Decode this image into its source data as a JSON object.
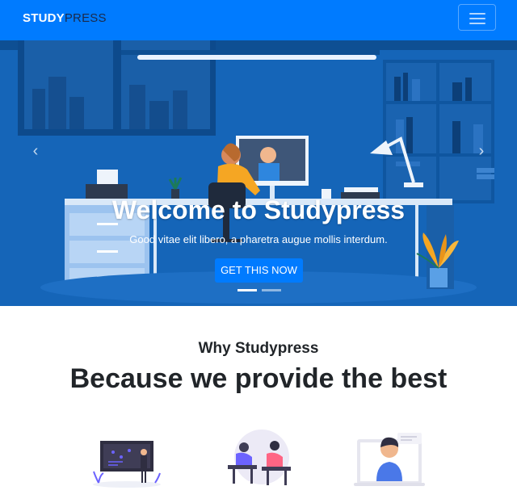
{
  "navbar": {
    "brand_part1": "STUDY",
    "brand_part2": "PRESS",
    "toggle_icon": "hamburger-menu-icon"
  },
  "hero": {
    "title": "Welcome to Studypress",
    "subtitle": "Good vitae elit libero, a pharetra augue mollis interdum.",
    "cta_label": "GET THIS NOW",
    "prev_icon": "chevron-left-icon",
    "next_icon": "chevron-right-icon",
    "prev_glyph": "‹",
    "next_glyph": "›",
    "slide_count": 2,
    "active_slide": 1
  },
  "why": {
    "subtitle": "Why Studypress",
    "title": "Because we provide the best"
  },
  "features": [
    {
      "icon": "teacher-presentation-icon"
    },
    {
      "icon": "students-studying-icon"
    },
    {
      "icon": "video-call-tutor-icon"
    }
  ],
  "colors": {
    "primary": "#007bff",
    "hero_bg": "#1565b8",
    "accent_orange": "#f5a623"
  }
}
